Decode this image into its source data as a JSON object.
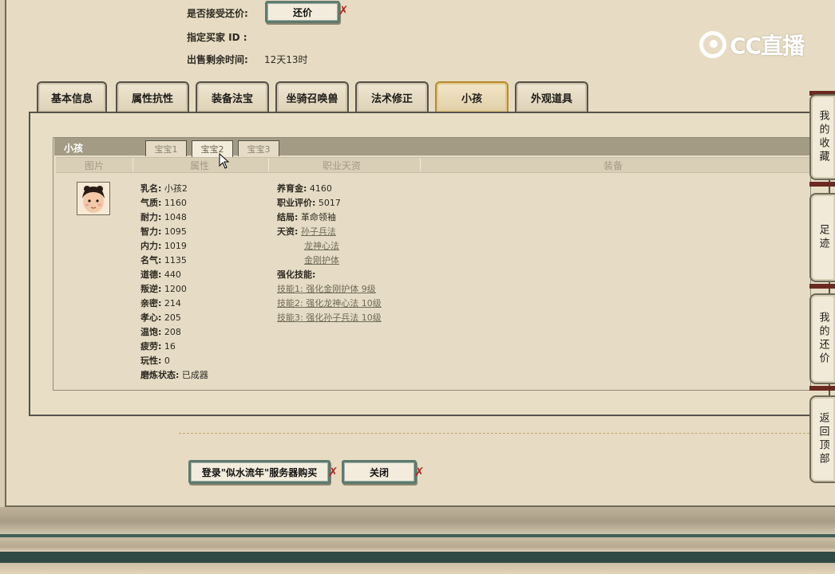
{
  "top_fields": {
    "accept_offer_label": "是否接受还价:",
    "offer_button": "还价",
    "buyer_id_label": "指定买家 ID :",
    "remaining_time_label": "出售剩余时间:",
    "remaining_time_value": "12天13时"
  },
  "logo_text": "CC直播",
  "tabs": [
    {
      "label": "基本信息"
    },
    {
      "label": "属性抗性"
    },
    {
      "label": "装备法宝"
    },
    {
      "label": "坐骑召唤兽"
    },
    {
      "label": "法术修正"
    },
    {
      "label": "小孩"
    },
    {
      "label": "外观道具"
    }
  ],
  "child_section": {
    "title": "小孩",
    "subtabs": [
      "宝宝1",
      "宝宝2",
      "宝宝3"
    ],
    "columns": [
      "图片",
      "属性",
      "职业天资",
      "装备"
    ],
    "attributes": [
      {
        "k": "乳名:",
        "v": "小孩2"
      },
      {
        "k": "气质:",
        "v": "1160"
      },
      {
        "k": "耐力:",
        "v": "1048"
      },
      {
        "k": "智力:",
        "v": "1095"
      },
      {
        "k": "内力:",
        "v": "1019"
      },
      {
        "k": "名气:",
        "v": "1135"
      },
      {
        "k": "道德:",
        "v": "440"
      },
      {
        "k": "叛逆:",
        "v": "1200"
      },
      {
        "k": "亲密:",
        "v": "214"
      },
      {
        "k": "孝心:",
        "v": "205"
      },
      {
        "k": "温饱:",
        "v": "208"
      },
      {
        "k": "疲劳:",
        "v": "16"
      },
      {
        "k": "玩性:",
        "v": "0"
      },
      {
        "k": "磨炼状态:",
        "v": "已成器"
      }
    ],
    "profession": {
      "money_k": "养育金:",
      "money_v": "4160",
      "rating_k": "职业评价:",
      "rating_v": "5017",
      "ending_k": "结局:",
      "ending_v": "革命领袖",
      "talent_k": "天资:",
      "talents": [
        "孙子兵法",
        "龙神心法",
        "金刚护体"
      ],
      "skills_k": "强化技能:",
      "skills": [
        "技能1: 强化金刚护体 9级",
        "技能2: 强化龙神心法 10级",
        "技能3: 强化孙子兵法 10级"
      ]
    }
  },
  "bottom_buttons": {
    "login_buy": "登录\"似水流年\"服务器购买",
    "close": "关闭"
  },
  "side_nav": [
    "我的收藏",
    "足迹",
    "我的还价",
    "返回顶部"
  ]
}
